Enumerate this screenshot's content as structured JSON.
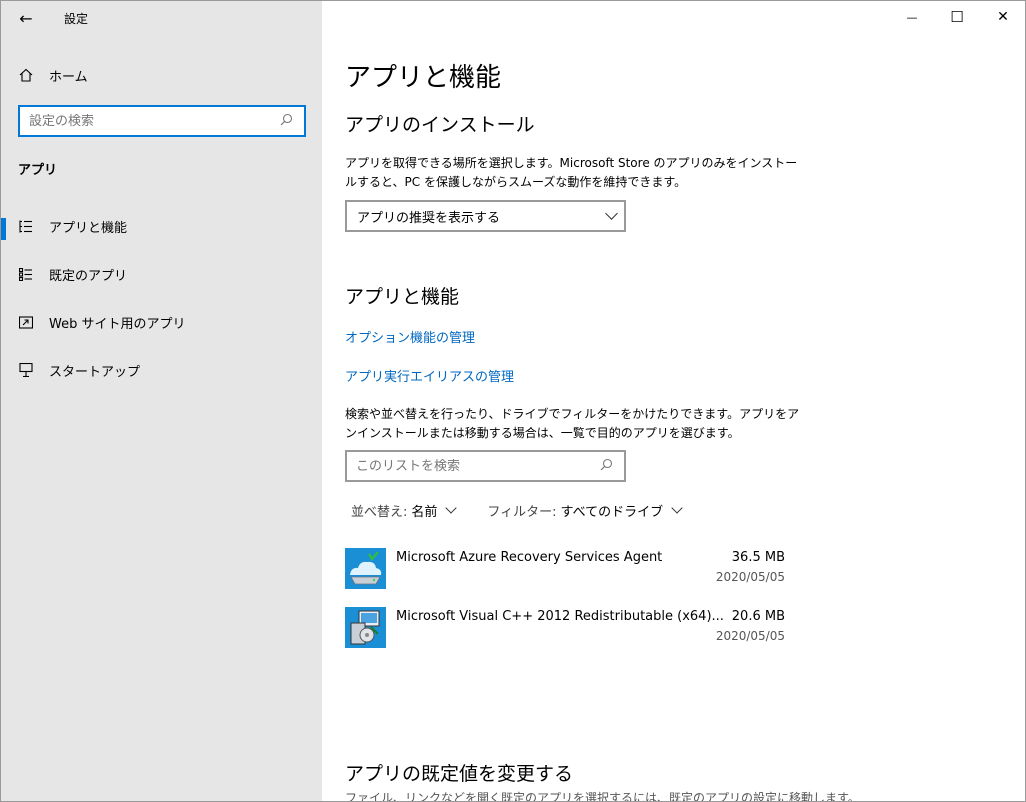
{
  "window": {
    "title": "設定",
    "controls": {
      "minimize": "—",
      "maximize": "☐",
      "close": "✕"
    }
  },
  "sidebar": {
    "home_label": "ホーム",
    "search_placeholder": "設定の検索",
    "section_label": "アプリ",
    "items": [
      {
        "label": "アプリと機能",
        "icon": "apps-features-icon",
        "active": true
      },
      {
        "label": "既定のアプリ",
        "icon": "default-apps-icon",
        "active": false
      },
      {
        "label": "Web サイト用のアプリ",
        "icon": "apps-for-websites-icon",
        "active": false
      },
      {
        "label": "スタートアップ",
        "icon": "startup-icon",
        "active": false
      }
    ]
  },
  "main": {
    "page_title": "アプリと機能",
    "install_section": {
      "heading": "アプリのインストール",
      "description": "アプリを取得できる場所を選択します。Microsoft Store のアプリのみをインストールすると、PC を保護しながらスムーズな動作を維持できます。",
      "dropdown_value": "アプリの推奨を表示する"
    },
    "features_section": {
      "heading": "アプリと機能",
      "link_optional": "オプション機能の管理",
      "link_alias": "アプリ実行エイリアスの管理",
      "description": "検索や並べ替えを行ったり、ドライブでフィルターをかけたりできます。アプリをアンインストールまたは移動する場合は、一覧で目的のアプリを選びます。",
      "list_search_placeholder": "このリストを検索",
      "sort_key": "並べ替え:",
      "sort_value": "名前",
      "filter_key": "フィルター:",
      "filter_value": "すべてのドライブ",
      "apps": [
        {
          "name": "Microsoft Azure Recovery Services Agent",
          "size": "36.5 MB",
          "date": "2020/05/05",
          "icon": "azure-recovery-icon"
        },
        {
          "name": "Microsoft Visual C++ 2012 Redistributable (x64)...",
          "size": "20.6 MB",
          "date": "2020/05/05",
          "icon": "installer-icon"
        }
      ]
    },
    "defaults_section": {
      "heading": "アプリの既定値を変更する",
      "description": "ファイル、リンクなどを開く既定のアプリを選択するには、既定のアプリの設定に移動します。"
    }
  },
  "colors": {
    "accent": "#0078d7",
    "link": "#0067c0",
    "sidebar_bg": "#e6e6e6"
  }
}
